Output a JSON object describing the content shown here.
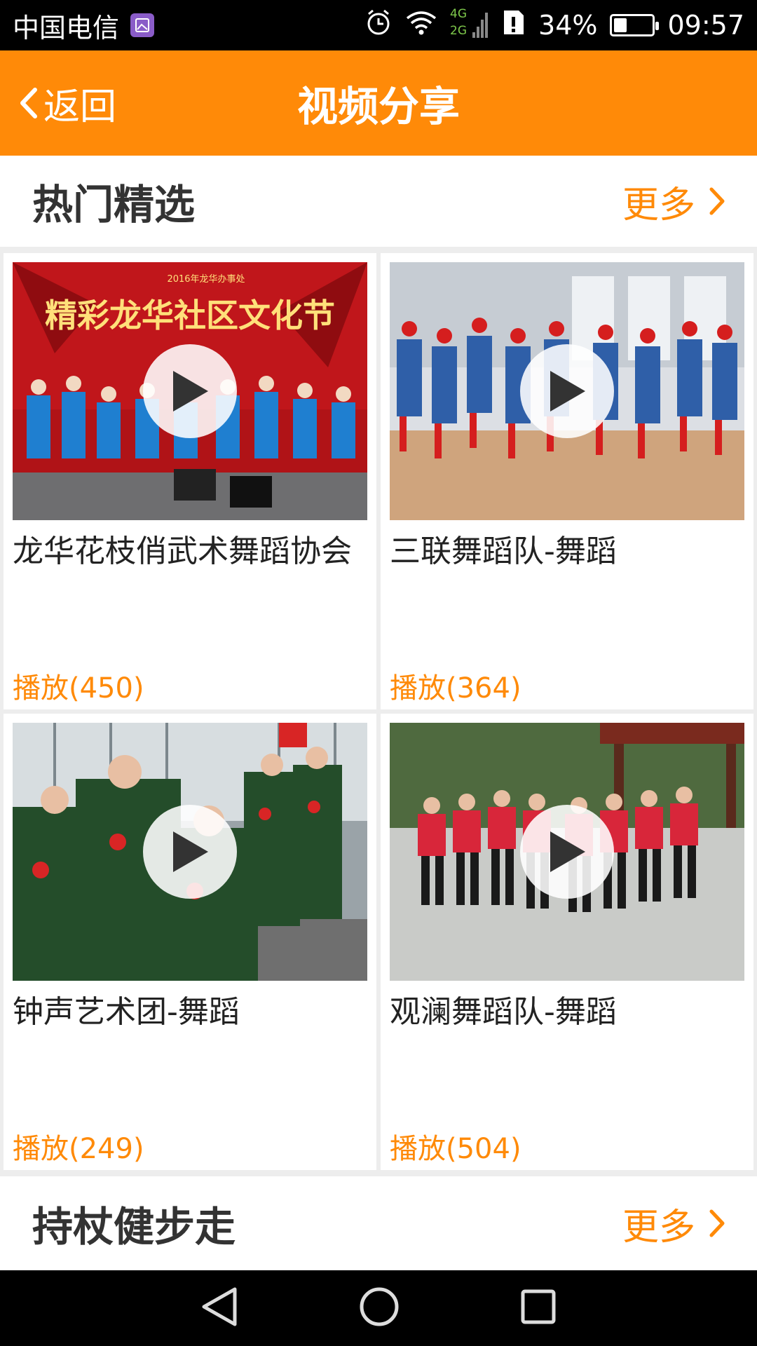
{
  "status_bar": {
    "carrier": "中国电信",
    "network_top": "4G",
    "network_bottom": "2G",
    "battery": "34%",
    "battery_level": 0.34,
    "time": "09:57"
  },
  "app_bar": {
    "back_label": "返回",
    "title": "视频分享"
  },
  "sections": [
    {
      "title": "热门精选",
      "more_label": "更多",
      "videos": [
        {
          "title": "龙华花枝俏武术舞蹈协会",
          "plays": "播放(450)",
          "banner": "精彩龙华社区文化节",
          "caption": "2016年龙华办事处"
        },
        {
          "title": "三联舞蹈队-舞蹈",
          "plays": "播放(364)"
        },
        {
          "title": "钟声艺术团-舞蹈",
          "plays": "播放(249)"
        },
        {
          "title": "观澜舞蹈队-舞蹈",
          "plays": "播放(504)"
        }
      ]
    },
    {
      "title": "持杖健步走",
      "more_label": "更多"
    }
  ],
  "colors": {
    "accent": "#ff8a08",
    "app_bar": "#ff8a08",
    "background": "#ededed"
  }
}
